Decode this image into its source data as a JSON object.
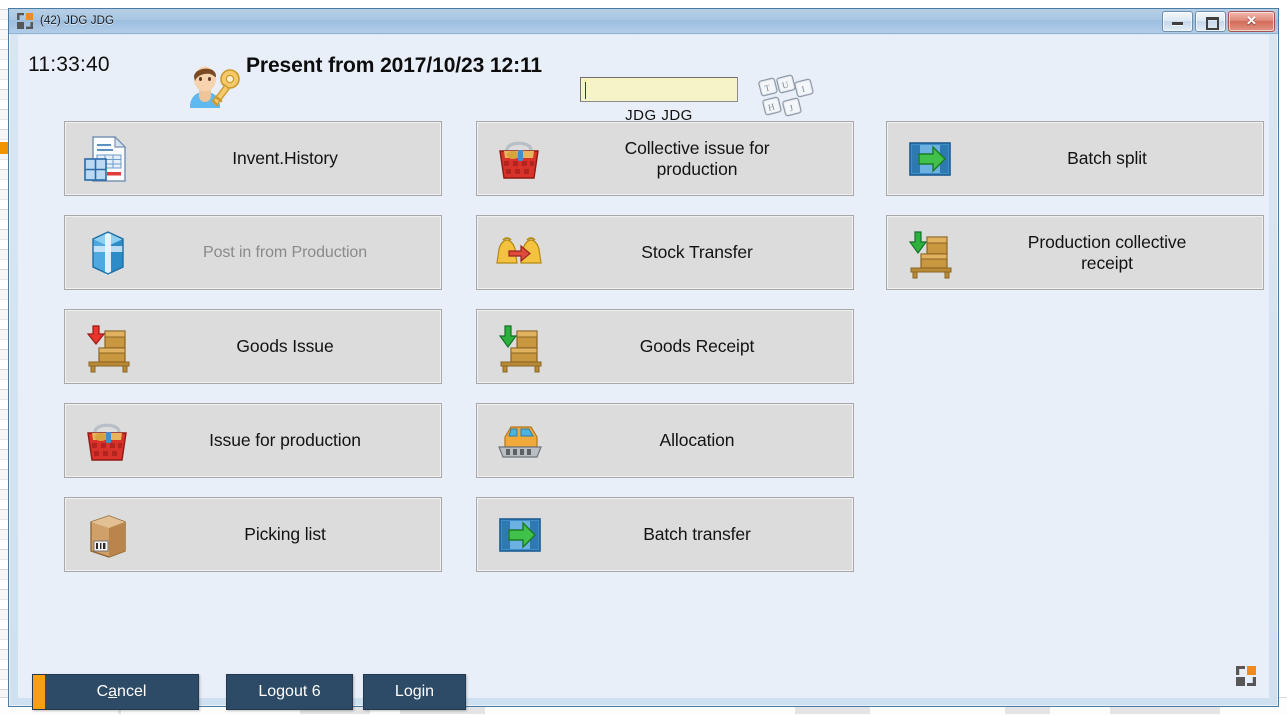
{
  "window": {
    "title": "(42) JDG JDG",
    "logo_icon": "app-logo-squares",
    "controls": {
      "minimize_label": "",
      "maximize_label": "",
      "close_label": "✕"
    }
  },
  "header": {
    "clock": "11:33:40",
    "user_icon": "user-with-key-icon",
    "present_text": "Present from 2017/10/23 12:11",
    "login_field": {
      "value": "",
      "placeholder": "",
      "background_color": "#f7f3c8"
    },
    "login_name": "JDG JDG",
    "keyboard_icon": "on-screen-keyboard-icon",
    "keyboard_keys": [
      "T",
      "U",
      "I",
      "H",
      "J"
    ]
  },
  "menu": {
    "columns": [
      {
        "items": [
          {
            "label": "Invent.History",
            "icon": "document-inventory-icon",
            "disabled": false
          },
          {
            "label": "Post in from Production",
            "icon": "blue-box-icon",
            "disabled": true
          },
          {
            "label": "Goods Issue",
            "icon": "pallet-up-arrow-icon",
            "disabled": false
          },
          {
            "label": "Issue for production",
            "icon": "red-basket-icon",
            "disabled": false
          },
          {
            "label": "Picking list",
            "icon": "cardboard-box-icon",
            "disabled": false
          }
        ]
      },
      {
        "items": [
          {
            "label": "Collective issue for\nproduction",
            "icon": "red-basket-icon",
            "disabled": false
          },
          {
            "label": "Stock Transfer",
            "icon": "two-bags-arrow-icon",
            "disabled": false
          },
          {
            "label": "Goods Receipt",
            "icon": "pallet-down-arrow-icon",
            "disabled": false
          },
          {
            "label": "Allocation",
            "icon": "forklift-icon",
            "disabled": false
          },
          {
            "label": "Batch transfer",
            "icon": "batch-arrow-icon",
            "disabled": false
          }
        ]
      },
      {
        "items": [
          {
            "label": "Batch split",
            "icon": "batch-arrow-icon",
            "disabled": false
          },
          {
            "label": "Production collective\nreceipt",
            "icon": "pallet-down-arrow-icon",
            "disabled": false
          }
        ]
      }
    ]
  },
  "actions": {
    "cancel": {
      "prefix": "C",
      "accel": "a",
      "suffix": "ncel",
      "accent_color": "#f5a013"
    },
    "logout": "Logout 6",
    "login": "Login"
  },
  "corner_logo_icon": "app-logo-squares",
  "colors": {
    "dialog_background": "#e9eff8",
    "button_face": "#dcdcdc",
    "action_button": "#2d4a66",
    "title_bar": "#a8c6e2",
    "field_yellow": "#f7f3c8",
    "accent_orange": "#f08a1e"
  }
}
